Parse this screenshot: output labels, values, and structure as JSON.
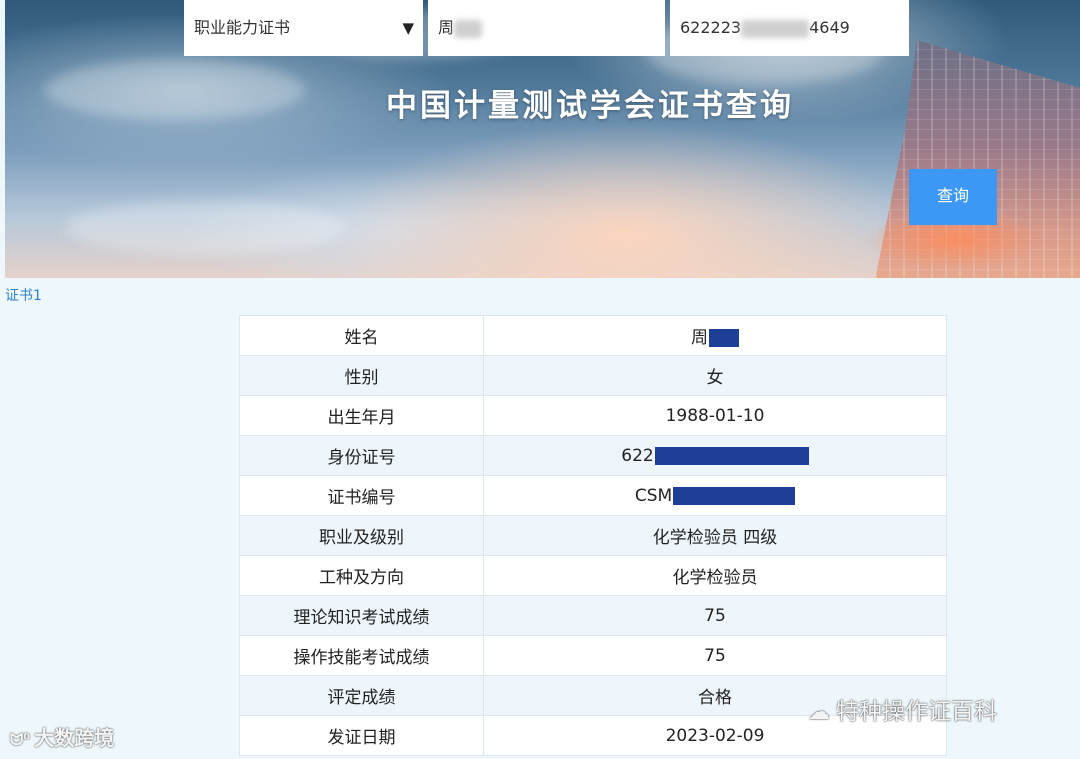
{
  "header": {
    "title": "中国计量测试学会证书查询"
  },
  "search": {
    "certificate_type": "职业能力证书",
    "dropdown_arrow": "▼",
    "name_value": "周",
    "id_prefix": "622223",
    "id_suffix": "4649",
    "query_label": "查询"
  },
  "results": {
    "tab_label": "证书1",
    "rows": [
      {
        "label": "姓名",
        "value": "周"
      },
      {
        "label": "性别",
        "value": "女"
      },
      {
        "label": "出生年月",
        "value": "1988-01-10"
      },
      {
        "label": "身份证号",
        "value": "622"
      },
      {
        "label": "证书编号",
        "value": "CSM"
      },
      {
        "label": "职业及级别",
        "value": "化学检验员 四级"
      },
      {
        "label": "工种及方向",
        "value": "化学检验员"
      },
      {
        "label": "理论知识考试成绩",
        "value": "75"
      },
      {
        "label": "操作技能考试成绩",
        "value": "75"
      },
      {
        "label": "评定成绩",
        "value": "合格"
      },
      {
        "label": "发证日期",
        "value": "2023-02-09"
      }
    ]
  },
  "watermarks": {
    "left": "大数跨境",
    "right": "特种操作证百科"
  },
  "colors": {
    "query_button": "#3d98f5",
    "tab_link": "#2f84c7",
    "redaction": "#1d3f95",
    "page_background": "#eef7fc"
  }
}
